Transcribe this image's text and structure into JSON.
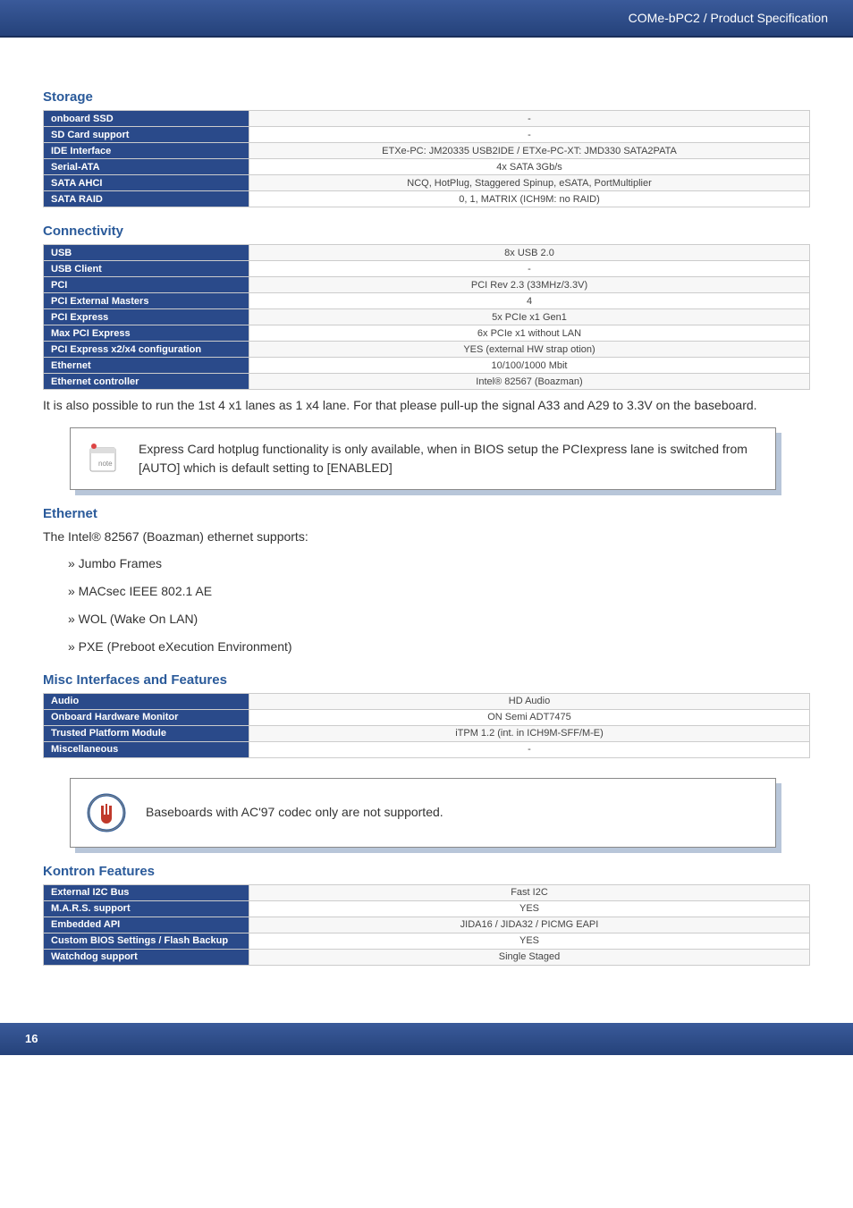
{
  "header": {
    "title": "COMe-bPC2 / Product Specification"
  },
  "footer": {
    "page": "16"
  },
  "sections": {
    "storage": {
      "title": "Storage",
      "rows": [
        {
          "label": "onboard SSD",
          "value": "-"
        },
        {
          "label": "SD Card support",
          "value": "-"
        },
        {
          "label": "IDE Interface",
          "value": "ETXe-PC: JM20335 USB2IDE / ETXe-PC-XT: JMD330 SATA2PATA"
        },
        {
          "label": "Serial-ATA",
          "value": "4x SATA 3Gb/s"
        },
        {
          "label": "SATA AHCI",
          "value": "NCQ, HotPlug, Staggered Spinup, eSATA, PortMultiplier"
        },
        {
          "label": "SATA RAID",
          "value": "0, 1, MATRIX (ICH9M: no RAID)"
        }
      ]
    },
    "connectivity": {
      "title": "Connectivity",
      "rows": [
        {
          "label": "USB",
          "value": "8x USB 2.0"
        },
        {
          "label": "USB Client",
          "value": "-"
        },
        {
          "label": "PCI",
          "value": "PCI Rev 2.3 (33MHz/3.3V)"
        },
        {
          "label": "PCI External Masters",
          "value": "4"
        },
        {
          "label": "PCI Express",
          "value": "5x PCIe x1 Gen1"
        },
        {
          "label": "Max PCI Express",
          "value": "6x PCIe x1 without LAN"
        },
        {
          "label": "PCI Express x2/x4 configuration",
          "value": "YES (external HW strap otion)"
        },
        {
          "label": "Ethernet",
          "value": "10/100/1000 Mbit"
        },
        {
          "label": "Ethernet controller",
          "value": "Intel® 82567 (Boazman)"
        }
      ],
      "note_after": "It is also possible to run the 1st 4 x1 lanes as 1 x4 lane. For that please pull-up the signal A33 and A29 to 3.3V on the baseboard."
    },
    "note_box": {
      "text": "Express Card hotplug functionality is only available, when in BIOS setup the PCIexpress lane is switched from [AUTO] which is default setting to [ENABLED]"
    },
    "ethernet": {
      "title": "Ethernet",
      "intro": "The Intel® 82567 (Boazman) ethernet supports:",
      "items": [
        "» Jumbo Frames",
        "» MACsec IEEE 802.1 AE",
        "» WOL (Wake On LAN)",
        "» PXE (Preboot eXecution Environment)"
      ]
    },
    "misc": {
      "title": "Misc Interfaces and Features",
      "rows": [
        {
          "label": "Audio",
          "value": "HD Audio"
        },
        {
          "label": "Onboard Hardware Monitor",
          "value": "ON Semi ADT7475"
        },
        {
          "label": "Trusted Platform Module",
          "value": "iTPM 1.2 (int. in ICH9M-SFF/M-E)"
        },
        {
          "label": "Miscellaneous",
          "value": "-"
        }
      ]
    },
    "warn_box": {
      "text": "Baseboards with AC'97 codec only are not supported."
    },
    "kontron": {
      "title": "Kontron Features",
      "rows": [
        {
          "label": "External I2C Bus",
          "value": "Fast I2C"
        },
        {
          "label": "M.A.R.S. support",
          "value": "YES"
        },
        {
          "label": "Embedded API",
          "value": "JIDA16 / JIDA32 / PICMG EAPI"
        },
        {
          "label": "Custom BIOS Settings / Flash Backup",
          "value": "YES"
        },
        {
          "label": "Watchdog support",
          "value": "Single Staged"
        }
      ]
    }
  }
}
